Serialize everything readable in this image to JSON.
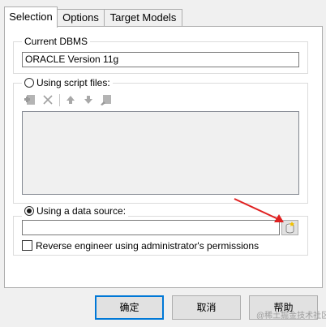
{
  "tabs": [
    "Selection",
    "Options",
    "Target Models"
  ],
  "current_dbms": {
    "legend": "Current DBMS",
    "value": "ORACLE Version 11g"
  },
  "script_files": {
    "radio_label": "Using script files:",
    "toolbar_icons": [
      "add-file-icon",
      "delete-icon",
      "move-up-icon",
      "move-down-icon",
      "edit-icon"
    ]
  },
  "data_source": {
    "radio_label": "Using a data source:",
    "value": "",
    "browse_icon": "database-icon",
    "admin_checkbox_label": "Reverse engineer using administrator's permissions"
  },
  "buttons": {
    "ok": "确定",
    "cancel": "取消",
    "help": "帮助"
  },
  "watermark": "@稀土掘金技术社区",
  "colors": {
    "annotation_arrow": "#e02020",
    "default_button_border": "#0078d7"
  }
}
